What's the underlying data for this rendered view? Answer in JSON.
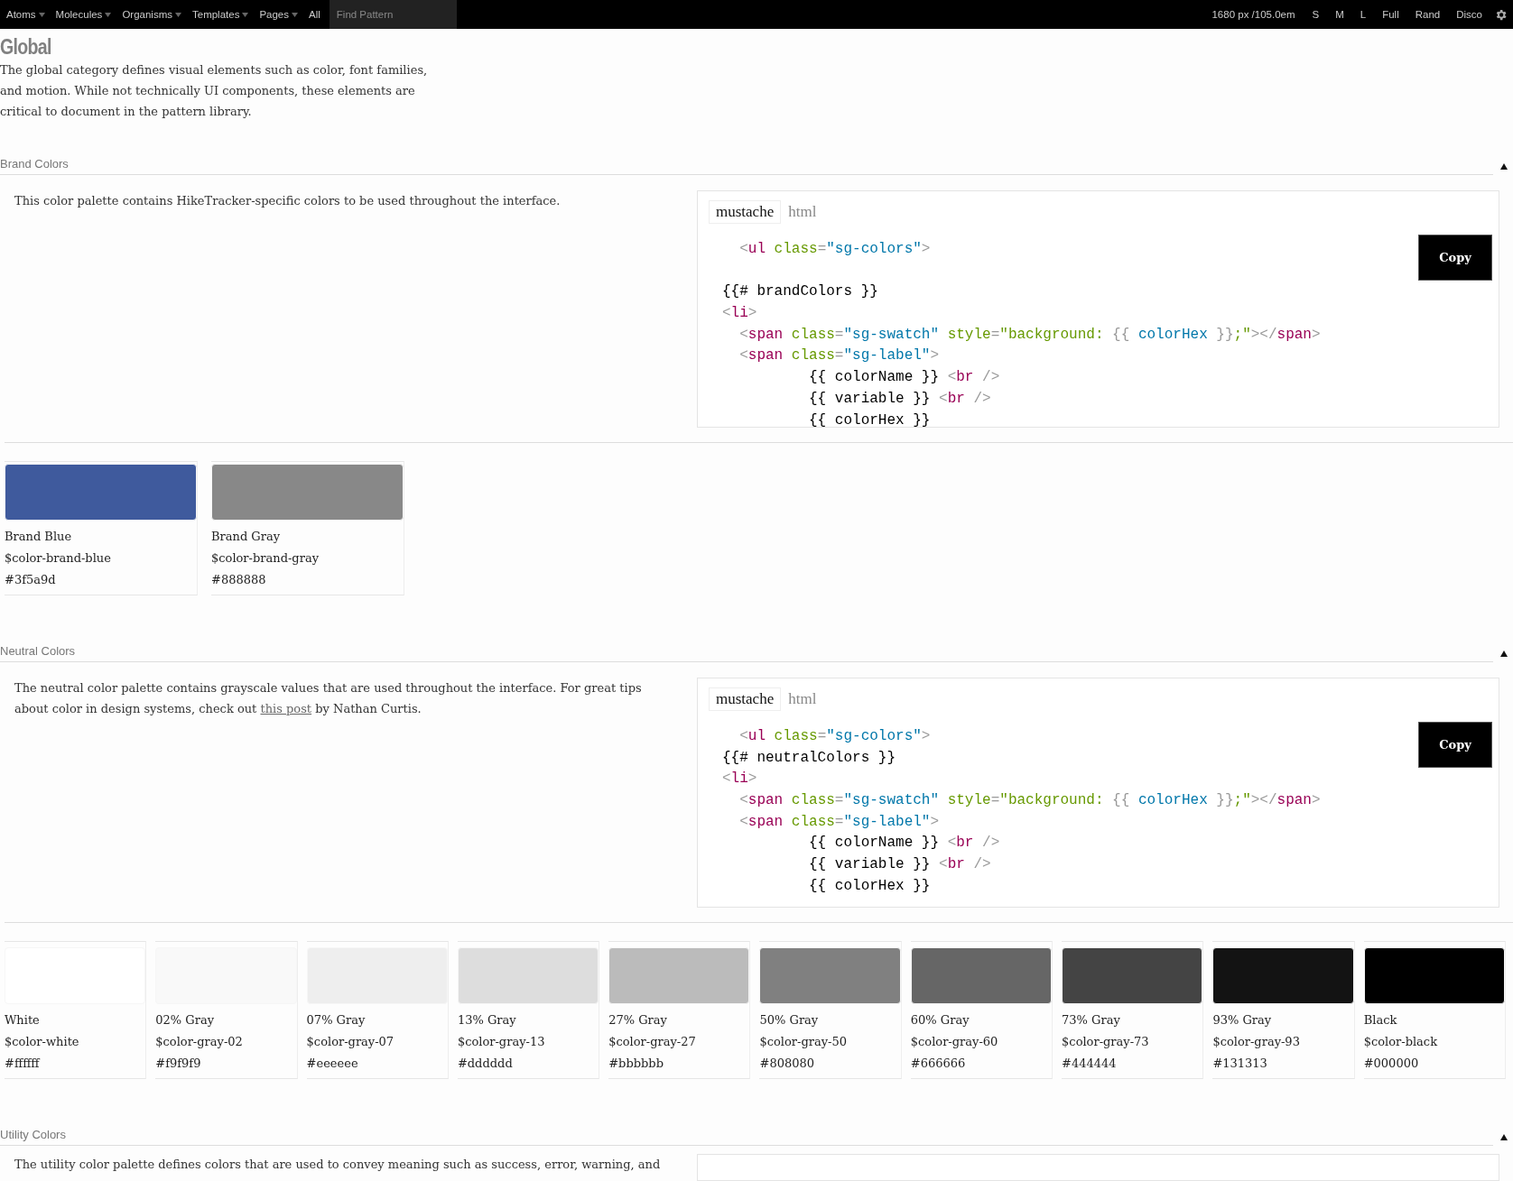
{
  "nav": {
    "menus": [
      {
        "label": "Atoms",
        "has_menu": true
      },
      {
        "label": "Molecules",
        "has_menu": true
      },
      {
        "label": "Organisms",
        "has_menu": true
      },
      {
        "label": "Templates",
        "has_menu": true
      },
      {
        "label": "Pages",
        "has_menu": true
      },
      {
        "label": "All",
        "has_menu": false
      }
    ],
    "search": {
      "placeholder": "Find Pattern"
    },
    "size_readout": "1680 px /105.0em",
    "size_buttons": [
      "S",
      "M",
      "L",
      "Full",
      "Rand",
      "Disco"
    ]
  },
  "page": {
    "title": "Global",
    "description": "The global category defines visual elements such as color, font families, and motion. While not technically UI components, these elements are critical to document in the pattern library."
  },
  "sections": [
    {
      "title": "Brand Colors",
      "description": {
        "text": "This color palette contains HikeTracker-specific colors to be used throughout the interface."
      },
      "code": {
        "tabs": [
          {
            "label": "mustache",
            "selected": true
          },
          {
            "label": "html",
            "selected": false
          }
        ],
        "copy": "Copy",
        "lines": [
          {
            "blank_after": true,
            "tokens": [
              {
                "kind": "p",
                "t": "  <"
              },
              {
                "kind": "tag",
                "t": "ul"
              },
              {
                "kind": "attr",
                "t": " class"
              },
              {
                "kind": "p",
                "t": "="
              },
              {
                "kind": "str",
                "t": "\"sg-colors\""
              },
              {
                "kind": "p",
                "t": ">"
              }
            ]
          },
          {
            "blank_after": false,
            "tokens": [
              {
                "kind": "txt",
                "t": "{{# brandColors }}"
              }
            ]
          },
          {
            "blank_after": false,
            "tokens": [
              {
                "kind": "p",
                "t": "<"
              },
              {
                "kind": "tag",
                "t": "li"
              },
              {
                "kind": "p",
                "t": ">"
              }
            ]
          },
          {
            "blank_after": false,
            "tokens": [
              {
                "kind": "p",
                "t": "  <"
              },
              {
                "kind": "tag",
                "t": "span"
              },
              {
                "kind": "attr",
                "t": " class"
              },
              {
                "kind": "p",
                "t": "="
              },
              {
                "kind": "str",
                "t": "\"sg-swatch\""
              },
              {
                "kind": "attr",
                "t": " style"
              },
              {
                "kind": "p",
                "t": "="
              },
              {
                "kind": "attr",
                "t": "\"background: "
              },
              {
                "kind": "p",
                "t": "{{"
              },
              {
                "kind": "str",
                "t": " colorHex "
              },
              {
                "kind": "p",
                "t": "}}"
              },
              {
                "kind": "attr",
                "t": ";\""
              },
              {
                "kind": "p",
                "t": "></"
              },
              {
                "kind": "tag",
                "t": "span"
              },
              {
                "kind": "p",
                "t": ">"
              }
            ]
          },
          {
            "blank_after": false,
            "tokens": [
              {
                "kind": "p",
                "t": "  <"
              },
              {
                "kind": "tag",
                "t": "span"
              },
              {
                "kind": "attr",
                "t": " class"
              },
              {
                "kind": "p",
                "t": "="
              },
              {
                "kind": "str",
                "t": "\"sg-label\""
              },
              {
                "kind": "p",
                "t": ">"
              }
            ]
          },
          {
            "blank_after": false,
            "tokens": [
              {
                "kind": "txt",
                "t": "          {{ colorName }} "
              },
              {
                "kind": "p",
                "t": "<"
              },
              {
                "kind": "tag",
                "t": "br"
              },
              {
                "kind": "p",
                "t": " />"
              }
            ]
          },
          {
            "blank_after": false,
            "tokens": [
              {
                "kind": "txt",
                "t": "          {{ variable }} "
              },
              {
                "kind": "p",
                "t": "<"
              },
              {
                "kind": "tag",
                "t": "br"
              },
              {
                "kind": "p",
                "t": " />"
              }
            ]
          },
          {
            "blank_after": false,
            "tokens": [
              {
                "kind": "txt",
                "t": "          {{ colorHex }}"
              }
            ]
          }
        ]
      },
      "swatches": [
        {
          "name": "Brand Blue",
          "variable": "$color-brand-blue",
          "hex": "#3f5a9d",
          "color": "#3f5a9d"
        },
        {
          "name": "Brand Gray",
          "variable": "$color-brand-gray",
          "hex": "#888888",
          "color": "#888888"
        }
      ]
    },
    {
      "title": "Neutral Colors",
      "description": {
        "text": "The neutral color palette contains grayscale values that are used throughout the interface. For great tips about color in design systems, check out ",
        "link": "this post",
        "text_after": " by Nathan Curtis."
      },
      "code": {
        "tabs": [
          {
            "label": "mustache",
            "selected": true
          },
          {
            "label": "html",
            "selected": false
          }
        ],
        "copy": "Copy",
        "lines": [
          {
            "blank_after": false,
            "tokens": [
              {
                "kind": "p",
                "t": "  <"
              },
              {
                "kind": "tag",
                "t": "ul"
              },
              {
                "kind": "attr",
                "t": " class"
              },
              {
                "kind": "p",
                "t": "="
              },
              {
                "kind": "str",
                "t": "\"sg-colors\""
              },
              {
                "kind": "p",
                "t": ">"
              }
            ]
          },
          {
            "blank_after": false,
            "tokens": [
              {
                "kind": "txt",
                "t": "{{# neutralColors }}"
              }
            ]
          },
          {
            "blank_after": false,
            "tokens": [
              {
                "kind": "p",
                "t": "<"
              },
              {
                "kind": "tag",
                "t": "li"
              },
              {
                "kind": "p",
                "t": ">"
              }
            ]
          },
          {
            "blank_after": false,
            "tokens": [
              {
                "kind": "p",
                "t": "  <"
              },
              {
                "kind": "tag",
                "t": "span"
              },
              {
                "kind": "attr",
                "t": " class"
              },
              {
                "kind": "p",
                "t": "="
              },
              {
                "kind": "str",
                "t": "\"sg-swatch\""
              },
              {
                "kind": "attr",
                "t": " style"
              },
              {
                "kind": "p",
                "t": "="
              },
              {
                "kind": "attr",
                "t": "\"background: "
              },
              {
                "kind": "p",
                "t": "{{"
              },
              {
                "kind": "str",
                "t": " colorHex "
              },
              {
                "kind": "p",
                "t": "}}"
              },
              {
                "kind": "attr",
                "t": ";\""
              },
              {
                "kind": "p",
                "t": "></"
              },
              {
                "kind": "tag",
                "t": "span"
              },
              {
                "kind": "p",
                "t": ">"
              }
            ]
          },
          {
            "blank_after": false,
            "tokens": [
              {
                "kind": "p",
                "t": "  <"
              },
              {
                "kind": "tag",
                "t": "span"
              },
              {
                "kind": "attr",
                "t": " class"
              },
              {
                "kind": "p",
                "t": "="
              },
              {
                "kind": "str",
                "t": "\"sg-label\""
              },
              {
                "kind": "p",
                "t": ">"
              }
            ]
          },
          {
            "blank_after": false,
            "tokens": [
              {
                "kind": "txt",
                "t": "          {{ colorName }} "
              },
              {
                "kind": "p",
                "t": "<"
              },
              {
                "kind": "tag",
                "t": "br"
              },
              {
                "kind": "p",
                "t": " />"
              }
            ]
          },
          {
            "blank_after": false,
            "tokens": [
              {
                "kind": "txt",
                "t": "          {{ variable }} "
              },
              {
                "kind": "p",
                "t": "<"
              },
              {
                "kind": "tag",
                "t": "br"
              },
              {
                "kind": "p",
                "t": " />"
              }
            ]
          },
          {
            "blank_after": false,
            "tokens": [
              {
                "kind": "txt",
                "t": "          {{ colorHex }}"
              }
            ]
          }
        ]
      },
      "swatches": [
        {
          "name": "White",
          "variable": "$color-white",
          "hex": "#ffffff",
          "color": "#ffffff"
        },
        {
          "name": "02% Gray",
          "variable": "$color-gray-02",
          "hex": "#f9f9f9",
          "color": "#f9f9f9"
        },
        {
          "name": "07% Gray",
          "variable": "$color-gray-07",
          "hex": "#eeeeee",
          "color": "#eeeeee"
        },
        {
          "name": "13% Gray",
          "variable": "$color-gray-13",
          "hex": "#dddddd",
          "color": "#dddddd"
        },
        {
          "name": "27% Gray",
          "variable": "$color-gray-27",
          "hex": "#bbbbbb",
          "color": "#bbbbbb"
        },
        {
          "name": "50% Gray",
          "variable": "$color-gray-50",
          "hex": "#808080",
          "color": "#808080"
        },
        {
          "name": "60% Gray",
          "variable": "$color-gray-60",
          "hex": "#666666",
          "color": "#666666"
        },
        {
          "name": "73% Gray",
          "variable": "$color-gray-73",
          "hex": "#444444",
          "color": "#444444"
        },
        {
          "name": "93% Gray",
          "variable": "$color-gray-93",
          "hex": "#131313",
          "color": "#131313"
        },
        {
          "name": "Black",
          "variable": "$color-black",
          "hex": "#000000",
          "color": "#000000"
        }
      ]
    },
    {
      "title": "Utility Colors",
      "description": {
        "text": "The utility color palette defines colors that are used to convey meaning such as success, error, warning, and"
      }
    }
  ]
}
